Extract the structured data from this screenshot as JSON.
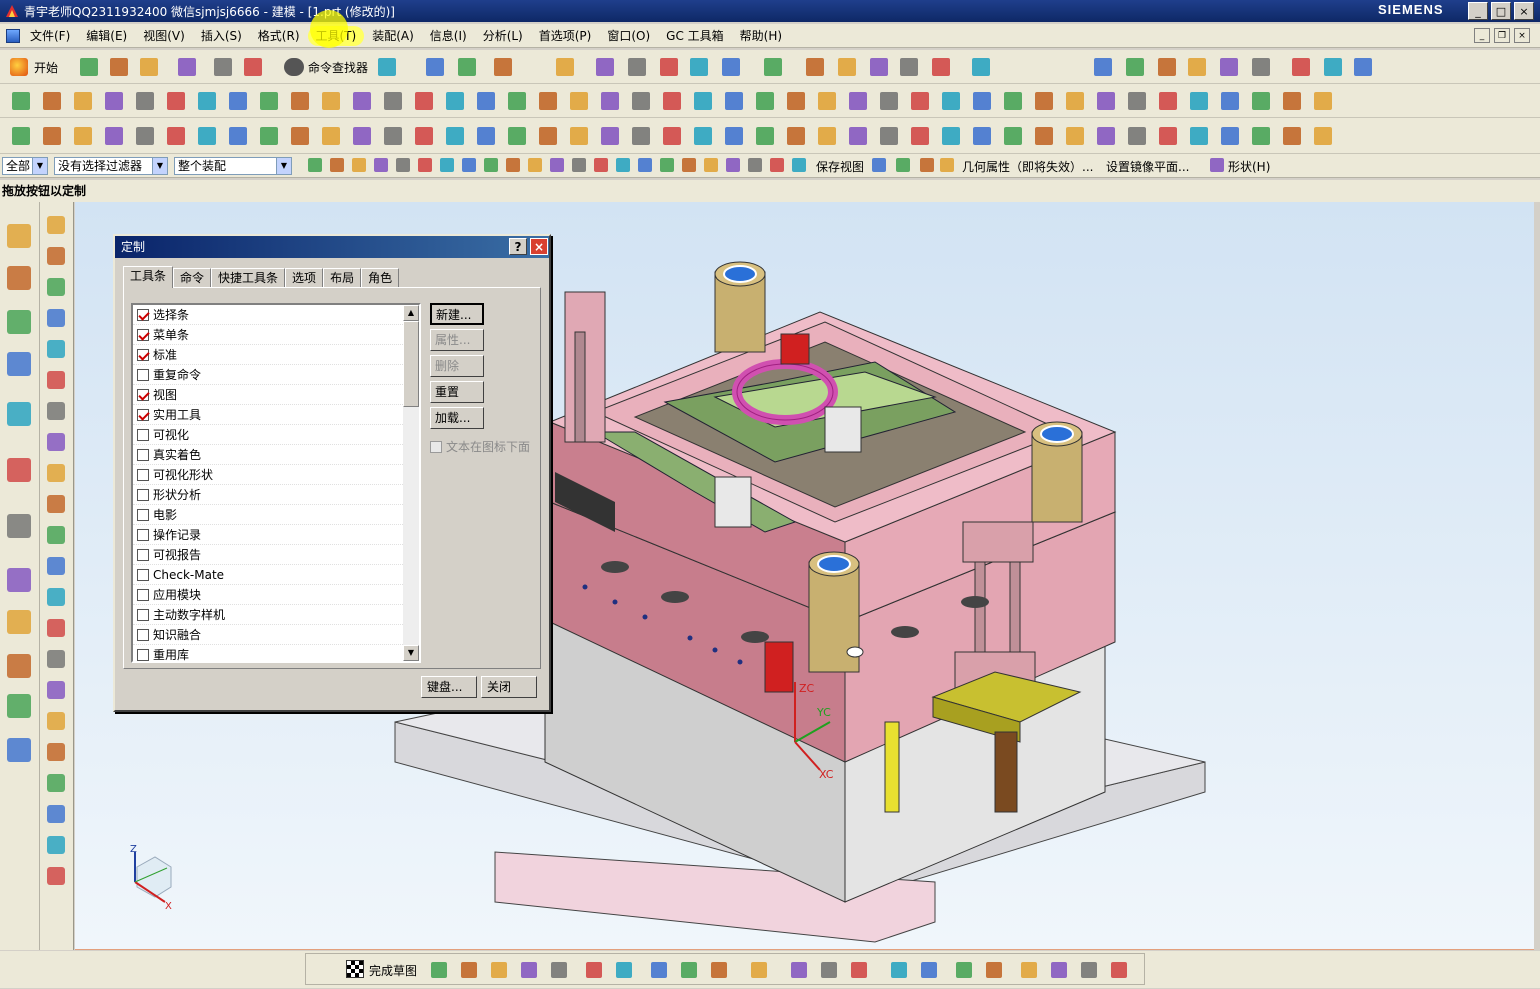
{
  "window": {
    "title": "青宇老师QQ2311932400 微信sjmjsj6666 - 建模 - [1.prt (修改的)]",
    "brand": "SIEMENS",
    "minimize_label": "_",
    "maximize_label": "□",
    "close_label": "×"
  },
  "menubar": {
    "items": [
      "文件(F)",
      "编辑(E)",
      "视图(V)",
      "插入(S)",
      "格式(R)",
      "工具(T)",
      "装配(A)",
      "信息(I)",
      "分析(L)",
      "首选项(P)",
      "窗口(O)",
      "GC 工具箱",
      "帮助(H)"
    ],
    "highlighted": "工具(T)"
  },
  "toolbar": {
    "start_label": "开始",
    "command_finder_label": "命令查找器"
  },
  "selection_bar": {
    "filter_all": "全部",
    "type_filter": "没有选择过滤器",
    "scope": "整个装配",
    "save_view_label": "保存视图",
    "geometry_props_label": "几何属性（即将失效）...",
    "mirror_plane_label": "设置镜像平面...",
    "shape_menu_label": "形状(H)"
  },
  "cue_line": "拖放按钮以定制",
  "bottom_bar": {
    "finish_sketch_label": "完成草图"
  },
  "dialog": {
    "title": "定制",
    "help_label": "?",
    "close_label": "×",
    "tabs": [
      "工具条",
      "命令",
      "快捷工具条",
      "选项",
      "布局",
      "角色"
    ],
    "active_tab": "工具条",
    "toolbars": [
      {
        "label": "选择条",
        "checked": true
      },
      {
        "label": "菜单条",
        "checked": true
      },
      {
        "label": "标准",
        "checked": true
      },
      {
        "label": "重复命令",
        "checked": false
      },
      {
        "label": "视图",
        "checked": true
      },
      {
        "label": "实用工具",
        "checked": true
      },
      {
        "label": "可视化",
        "checked": false
      },
      {
        "label": "真实着色",
        "checked": false
      },
      {
        "label": "可视化形状",
        "checked": false
      },
      {
        "label": "形状分析",
        "checked": false
      },
      {
        "label": "电影",
        "checked": false
      },
      {
        "label": "操作记录",
        "checked": false
      },
      {
        "label": "可视报告",
        "checked": false
      },
      {
        "label": "Check-Mate",
        "checked": false
      },
      {
        "label": "应用模块",
        "checked": false
      },
      {
        "label": "主动数字样机",
        "checked": false
      },
      {
        "label": "知识融合",
        "checked": false
      },
      {
        "label": "重用库",
        "checked": false
      }
    ],
    "buttons": {
      "new": "新建...",
      "properties": "属性...",
      "delete": "删除",
      "reset": "重置",
      "load": "加载..."
    },
    "text_below_icons_label": "文本在图标下面",
    "text_below_icons_checked": false,
    "keyboard_label": "键盘...",
    "close_button_label": "关闭"
  },
  "viewport": {
    "triad_labels": {
      "z": "Z",
      "x": "X"
    },
    "wcs_labels": {
      "zc": "ZC",
      "yc": "YC",
      "xc": "XC"
    }
  }
}
